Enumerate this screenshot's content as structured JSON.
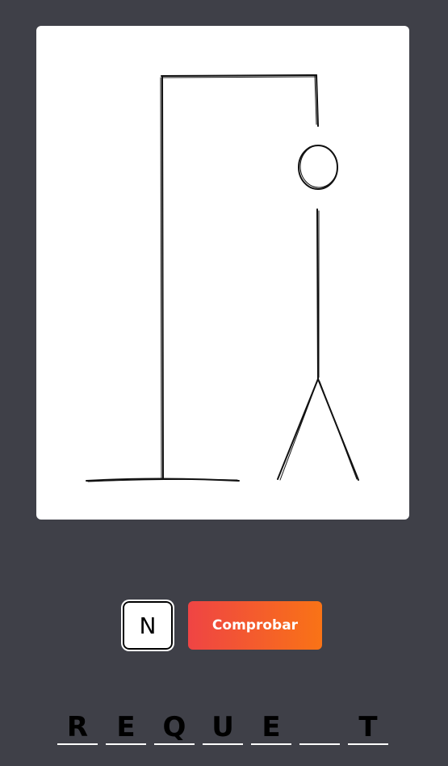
{
  "hangman": {
    "parts_drawn": [
      "gallows",
      "rope",
      "head",
      "body",
      "left-leg",
      "right-leg"
    ]
  },
  "guess": {
    "input_value": "N",
    "check_label": "Comprobar"
  },
  "word": {
    "slots": [
      "R",
      "E",
      "Q",
      "U",
      "E",
      "",
      "T"
    ]
  },
  "colors": {
    "background": "#3f4048",
    "board": "#ffffff",
    "button_gradient_start": "#ef4444",
    "button_gradient_end": "#f97316"
  }
}
